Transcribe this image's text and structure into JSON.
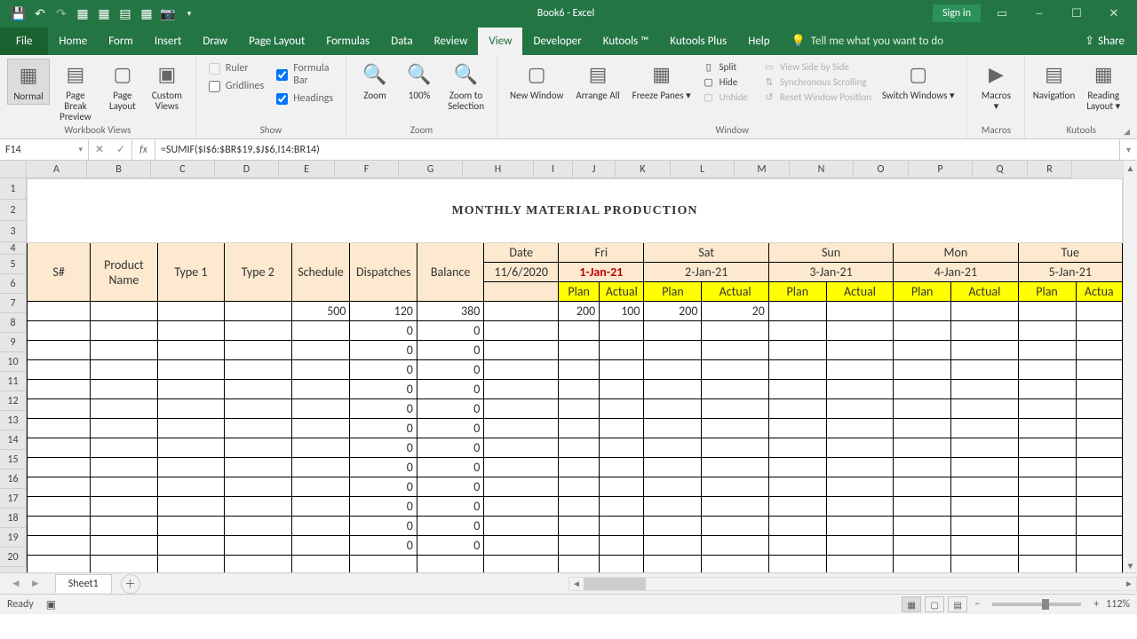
{
  "app": {
    "title": "Book6  -  Excel"
  },
  "title_buttons": {
    "signin": "Sign in"
  },
  "tabs": {
    "file": "File",
    "items": [
      "Home",
      "Form",
      "Insert",
      "Draw",
      "Page Layout",
      "Formulas",
      "Data",
      "Review",
      "View",
      "Developer",
      "Kutools ™",
      "Kutools Plus",
      "Help"
    ],
    "active": "View",
    "tell": "Tell me what you want to do",
    "share": "Share"
  },
  "ribbon": {
    "views": {
      "normal": "Normal",
      "page_break": "Page Break Preview",
      "page_layout": "Page Layout",
      "custom": "Custom Views",
      "group": "Workbook Views"
    },
    "show": {
      "ruler": "Ruler",
      "formula_bar": "Formula Bar",
      "gridlines": "Gridlines",
      "headings": "Headings",
      "group": "Show"
    },
    "zoom": {
      "zoom": "Zoom",
      "hundred": "100%",
      "to_sel": "Zoom to Selection",
      "group": "Zoom"
    },
    "window": {
      "new": "New Window",
      "arrange": "Arrange All",
      "freeze": "Freeze Panes",
      "split": "Split",
      "hide": "Hide",
      "unhide": "Unhide",
      "side": "View Side by Side",
      "sync": "Synchronous Scrolling",
      "reset": "Reset Window Position",
      "switch": "Switch Windows",
      "group": "Window"
    },
    "macros": {
      "macros": "Macros",
      "group": "Macros"
    },
    "kutools": {
      "nav": "Navigation",
      "layout": "Reading Layout",
      "group": "Kutools"
    }
  },
  "formula": {
    "namebox": "F14",
    "fx": "fx",
    "value": "=SUMIF($I$6:$BR$19,$J$6,I14:BR14)"
  },
  "columns": [
    "A",
    "B",
    "C",
    "D",
    "E",
    "F",
    "G",
    "H",
    "I",
    "J",
    "K",
    "L",
    "M",
    "N",
    "O",
    "P",
    "Q",
    "R"
  ],
  "rows": [
    "1",
    "2",
    "3",
    "4",
    "5",
    "6",
    "7",
    "8",
    "9",
    "10",
    "11",
    "12",
    "13",
    "14",
    "15",
    "16",
    "17",
    "18",
    "19",
    "20"
  ],
  "sheet": {
    "title": "MONTHLY MATERIAL PRODUCTION",
    "headers": {
      "snum": "S#",
      "product": "Product Name",
      "type1": "Type 1",
      "type2": "Type 2",
      "schedule": "Schedule",
      "dispatches": "Dispatches",
      "balance": "Balance",
      "date_label": "Date",
      "date_val": "11/6/2020"
    },
    "days": [
      {
        "day": "Fri",
        "date": "1-Jan-21",
        "red": true
      },
      {
        "day": "Sat",
        "date": "2-Jan-21"
      },
      {
        "day": "Sun",
        "date": "3-Jan-21"
      },
      {
        "day": "Mon",
        "date": "4-Jan-21"
      },
      {
        "day": "Tue",
        "date": "5-Jan-21"
      }
    ],
    "plan": "Plan",
    "actual": "Actual",
    "actual_cut": "Actua",
    "data_row7": {
      "schedule": "500",
      "dispatches": "120",
      "balance": "380",
      "i": "200",
      "j": "100",
      "k": "200",
      "l": "20"
    },
    "zero": "0"
  },
  "tabs_bottom": {
    "sheet1": "Sheet1"
  },
  "status": {
    "ready": "Ready",
    "zoom": "112%"
  }
}
